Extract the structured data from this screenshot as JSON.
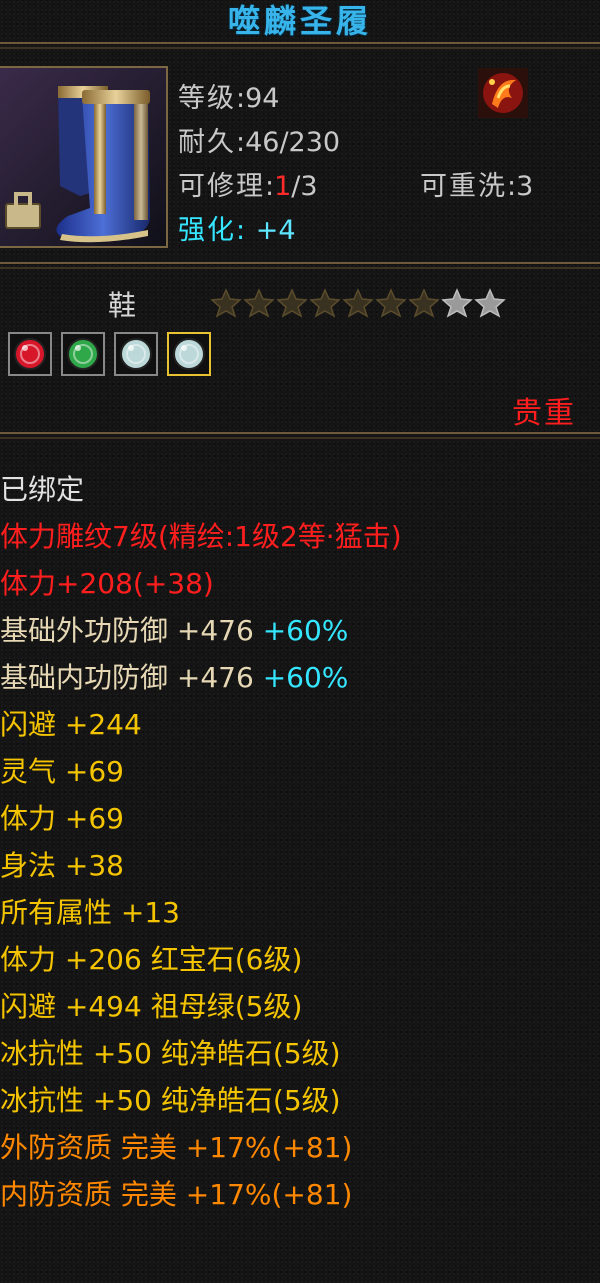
{
  "item": {
    "name": "噬麟圣履",
    "level_label": "等级",
    "level_value": ":94",
    "durability_label": "耐久",
    "durability_value": ":46/230",
    "repair_label": "可修理",
    "repair_sep": ":",
    "repair_current": "1",
    "repair_max": "/3",
    "rewash_label": "可重洗",
    "rewash_value": ":3",
    "enhance_label": "强化:",
    "enhance_value": "+4",
    "type": "鞋",
    "stars_total": 9,
    "stars_filled": 7,
    "precious": "贵重"
  },
  "gems": [
    {
      "name": "ruby-gem-icon",
      "color": "#d8162a",
      "selected": false
    },
    {
      "name": "emerald-gem-icon",
      "color": "#2fa84a",
      "selected": false
    },
    {
      "name": "white-gem-icon",
      "color": "#bcd8d8",
      "selected": false
    },
    {
      "name": "white-gem-icon-2",
      "color": "#bcd8d8",
      "selected": true
    }
  ],
  "attributes": [
    {
      "text": "已绑定",
      "color": "white"
    },
    {
      "text": "体力雕纹7级(精绘:1级2等·猛击)",
      "color": "red"
    },
    {
      "text": "体力+208(+38)",
      "color": "red"
    },
    {
      "text": "基础外功防御 +476",
      "extra": "+60%",
      "color": "tan"
    },
    {
      "text": "基础内功防御 +476",
      "extra": "+60%",
      "color": "tan"
    },
    {
      "text": "闪避 +244",
      "color": "yellow"
    },
    {
      "text": "灵气 +69",
      "color": "yellow"
    },
    {
      "text": "体力 +69",
      "color": "yellow"
    },
    {
      "text": "身法 +38",
      "color": "yellow"
    },
    {
      "text": "所有属性 +13",
      "color": "yellow"
    },
    {
      "text": "体力 +206 红宝石(6级)",
      "color": "yellow"
    },
    {
      "text": "闪避 +494 祖母绿(5级)",
      "color": "yellow"
    },
    {
      "text": "冰抗性 +50 纯净皓石(5级)",
      "color": "yellow"
    },
    {
      "text": "冰抗性 +50 纯净皓石(5级)",
      "color": "yellow"
    },
    {
      "text": "外防资质 完美 +17%(+81)",
      "color": "orange"
    },
    {
      "text": "内防资质 完美 +17%(+81)",
      "color": "orange"
    }
  ],
  "colors": {
    "title": "#37b4ea",
    "border": "#7b6742",
    "red": "#ff1e1e",
    "cyan": "#35e6ff",
    "yellow": "#f5c400",
    "orange": "#ff8800",
    "tan": "#e6d8b4"
  }
}
